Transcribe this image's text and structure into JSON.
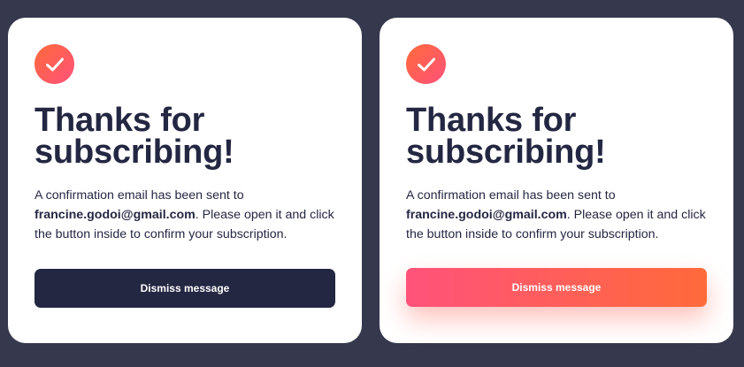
{
  "cards": [
    {
      "state": "default",
      "title_line1": "Thanks for",
      "title_line2": "subscribing!",
      "message_prefix": "A confirmation email has been sent to ",
      "email": "francine.godoi@gmail.com",
      "message_suffix": ". Please open it and click the button inside to confirm your subscription.",
      "button_label": "Dismiss message",
      "button_color": "#242742"
    },
    {
      "state": "hover",
      "title_line1": "Thanks for",
      "title_line2": "subscribing!",
      "message_prefix": "A confirmation email has been sent to ",
      "email": "francine.godoi@gmail.com",
      "message_suffix": ". Please open it and click the button inside to confirm your subscription.",
      "button_label": "Dismiss message",
      "button_gradient": [
        "#ff527b",
        "#ff6a3a"
      ]
    }
  ],
  "colors": {
    "background": "#36384d",
    "card": "#ffffff",
    "text": "#242742",
    "accent_start": "#ff527b",
    "accent_end": "#ff6a3a"
  },
  "icons": {
    "status": "check-icon"
  }
}
